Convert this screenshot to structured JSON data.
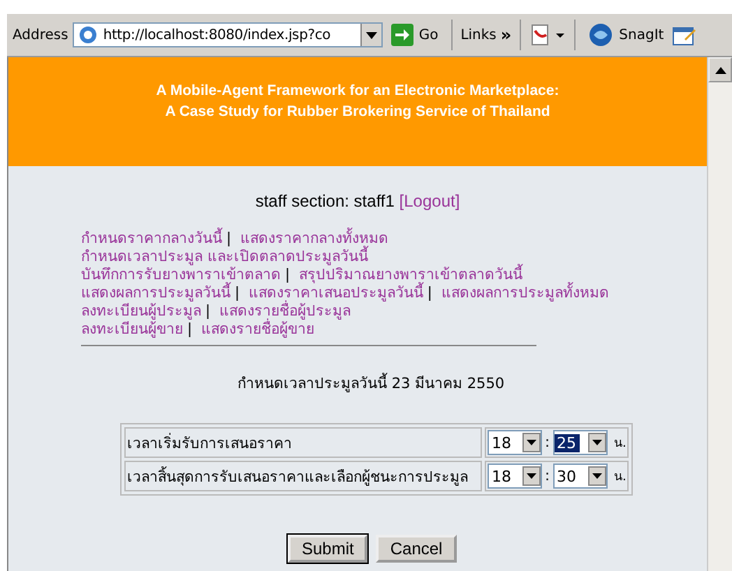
{
  "toolbar": {
    "address_label": "Address",
    "url": "http://localhost:8080/index.jsp?co",
    "go": "Go",
    "links": "Links",
    "chevron": "»",
    "snagit": "SnagIt"
  },
  "banner": {
    "title_lines": [
      "A Mobile-Agent Framework for an Electronic Marketplace:",
      "A Case Study for Rubber Brokering Service of Thailand"
    ]
  },
  "staff": {
    "text": "staff section: staff1",
    "logout": "[Logout]"
  },
  "separator": "|",
  "menu_lines": [
    [
      "กำหนดราคากลางวันนี้",
      "แสดงราคากลางทั้งหมด"
    ],
    [
      "กำหนดเวลาประมูล และเปิดตลาดประมูลวันนี้"
    ],
    [
      "บันทึกการรับยางพาราเข้าตลาด",
      "สรุปปริมาณยางพาราเข้าตลาดวันนี้"
    ],
    [
      "แสดงผลการประมูลวันนี้",
      "แสดงราคาเสนอประมูลวันนี้",
      "แสดงผลการประมูลทั้งหมด"
    ],
    [
      "ลงทะเบียนผู้ประมูล",
      "แสดงรายชื่อผู้ประมูล"
    ],
    [
      "ลงทะเบียนผู้ขาย",
      "แสดงรายชื่อผู้ขาย"
    ]
  ],
  "form_title": "กำหนดเวลาประมูลวันนี้ 23 มีนาคม 2550",
  "time_rows": [
    {
      "label": "เวลาเริ่มรับการเสนอราคา",
      "hour": "18",
      "colon": ":",
      "minute": "25",
      "minute_focused": true,
      "unit": "น."
    },
    {
      "label": "เวลาสิ้นสุดการรับเสนอราคาและเลือกผู้ชนะการประมูล",
      "hour": "18",
      "colon": ":",
      "minute": "30",
      "minute_focused": false,
      "unit": "น."
    }
  ],
  "buttons": [
    "Submit",
    "Cancel"
  ]
}
